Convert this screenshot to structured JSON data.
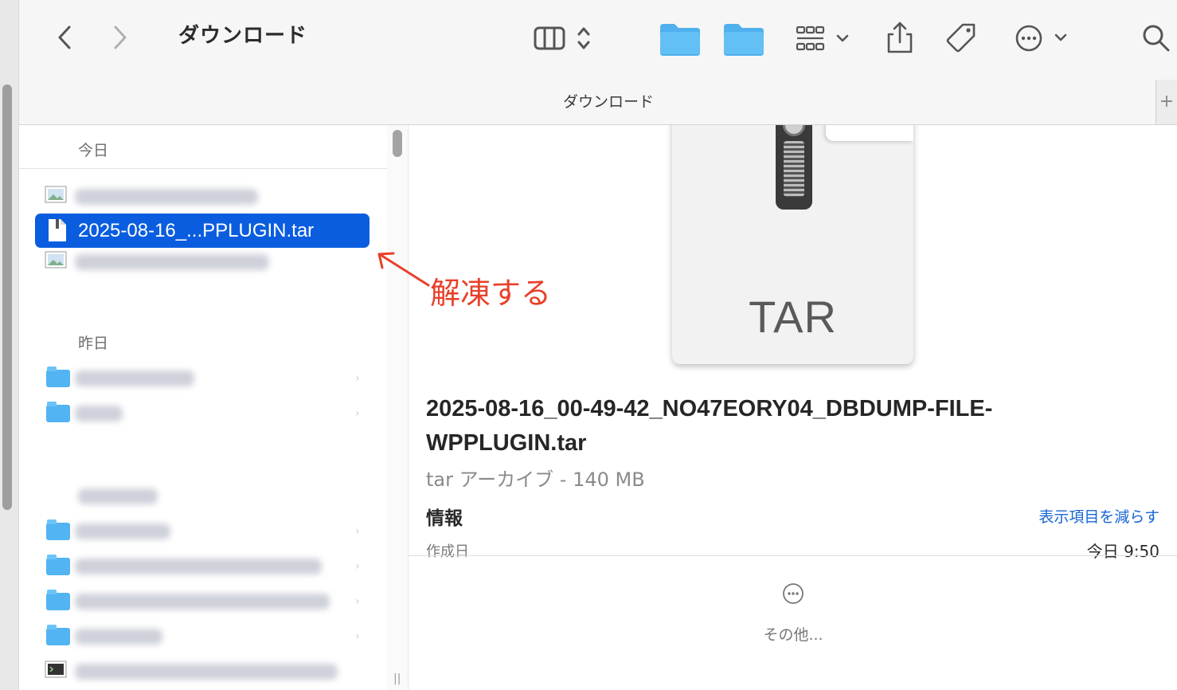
{
  "window": {
    "title": "ダウンロード",
    "tab_title": "ダウンロード",
    "tab_plus": "+"
  },
  "toolbar": {
    "icons": [
      "back-icon",
      "forward-icon",
      "column-view-icon",
      "view-switch-icon",
      "folder-icon",
      "folder-icon",
      "group-icon",
      "share-icon",
      "tag-icon",
      "more-actions-icon",
      "search-icon"
    ]
  },
  "sidebar": {
    "section_today": "今日",
    "section_yesterday": "昨日",
    "selected_file": "2025-08-16_...PPLUGIN.tar"
  },
  "preview": {
    "doc_label": "TAR",
    "file_name": "2025-08-16_00-49-42_NO47EORY04_DBDUMP-FILE-WPPLUGIN.tar",
    "file_type": "tar アーカイブ - 140 MB",
    "info_label": "情報",
    "show_less": "表示項目を減らす",
    "created_label": "作成日",
    "created_value": "今日 9:50",
    "more_label": "その他..."
  },
  "annotation": {
    "text": "解凍する",
    "color": "#e8402a"
  },
  "colors": {
    "selection": "#0a5ddf",
    "folder": "#52b4f2",
    "link": "#1766d6"
  }
}
